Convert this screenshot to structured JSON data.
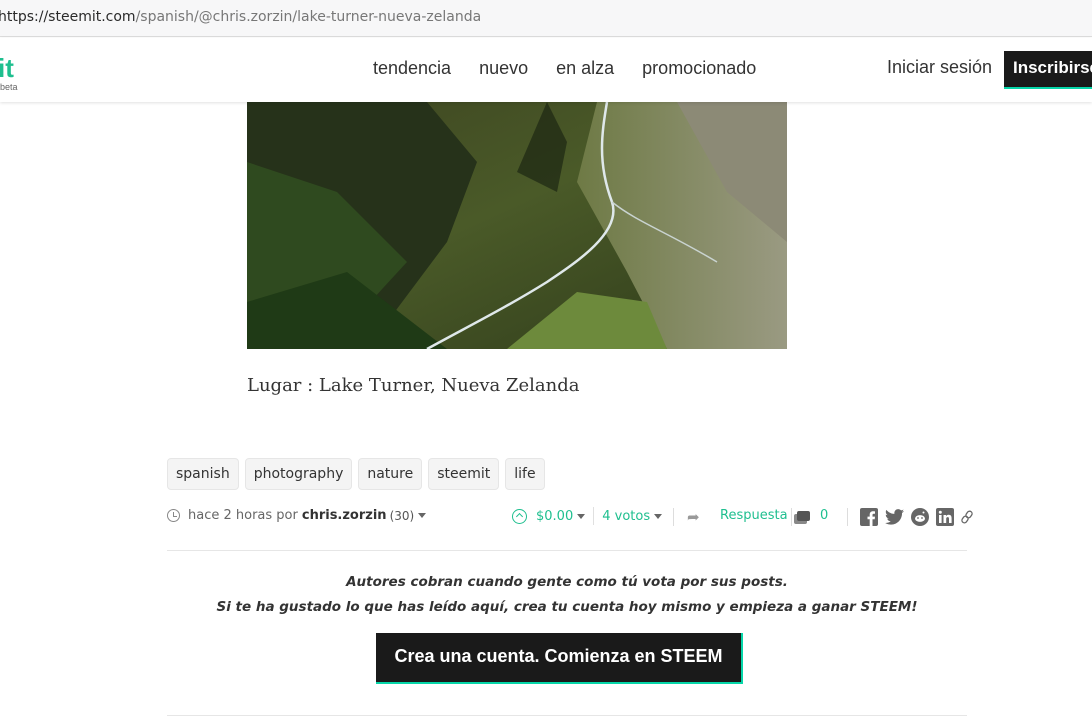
{
  "browser": {
    "url_domain": "https://steemit.com",
    "url_path": "/spanish/@chris.zorzin/lake-turner-nueva-zelanda"
  },
  "header": {
    "logo_text": "it",
    "logo_sub": "beta",
    "nav": [
      "tendencia",
      "nuevo",
      "en alza",
      "promocionado"
    ],
    "signin_label": "Iniciar sesión",
    "signup_label": "Inscribirse"
  },
  "post": {
    "caption": "Lugar : Lake Turner, Nueva Zelanda",
    "tags": [
      "spanish",
      "photography",
      "nature",
      "steemit",
      "life"
    ],
    "time": "hace 2 horas por",
    "author": "chris.zorzin",
    "reputation": "(30)",
    "payout": "$0.00",
    "votes": "4 votos",
    "reply_label": "Respuesta",
    "comment_count": "0"
  },
  "promo": {
    "line1": "Autores cobran cuando gente como tú vota por sus posts.",
    "line2": "Si te ha gustado lo que has leído aquí, crea tu cuenta hoy mismo y empieza a ganar STEEM!",
    "cta_label": "Crea una cuenta. Comienza en STEEM"
  },
  "colors": {
    "accent": "#1fbf8f",
    "dark": "#1a1a1a",
    "cta_border": "#06d6a9"
  },
  "icons": [
    "clock-icon",
    "upvote-icon",
    "resteem-icon",
    "comments-icon",
    "facebook-icon",
    "twitter-icon",
    "reddit-icon",
    "linkedin-icon",
    "link-icon"
  ]
}
